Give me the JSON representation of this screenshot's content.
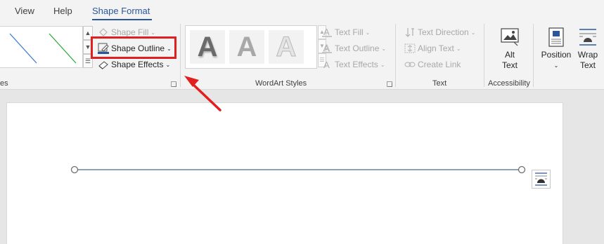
{
  "tabs": [
    {
      "label": "View"
    },
    {
      "label": "Help"
    },
    {
      "label": "Shape Format",
      "active": true
    }
  ],
  "insert_shapes": {
    "group_label_fragment": "es"
  },
  "shape_styles": {
    "shape_fill": "Shape Fill",
    "shape_outline": "Shape Outline",
    "shape_effects": "Shape Effects",
    "style_colors": [
      "#3a7bd5",
      "#2eaa3c"
    ]
  },
  "wordart_styles": {
    "tiles": [
      "A",
      "A",
      "A"
    ],
    "text_fill": "Text Fill",
    "text_outline": "Text Outline",
    "text_effects": "Text Effects",
    "group_label": "WordArt Styles"
  },
  "text_group": {
    "text_direction": "Text Direction",
    "align_text": "Align Text",
    "create_link": "Create Link",
    "group_label": "Text"
  },
  "accessibility": {
    "alt_text_line1": "Alt",
    "alt_text_line2": "Text",
    "group_label": "Accessibility"
  },
  "arrange": {
    "position": "Position",
    "wrap_line1": "Wrap",
    "wrap_line2": "Text"
  },
  "colors": {
    "accent": "#2b579a",
    "highlight": "#e21f1f",
    "line": "#4a6a8a"
  }
}
